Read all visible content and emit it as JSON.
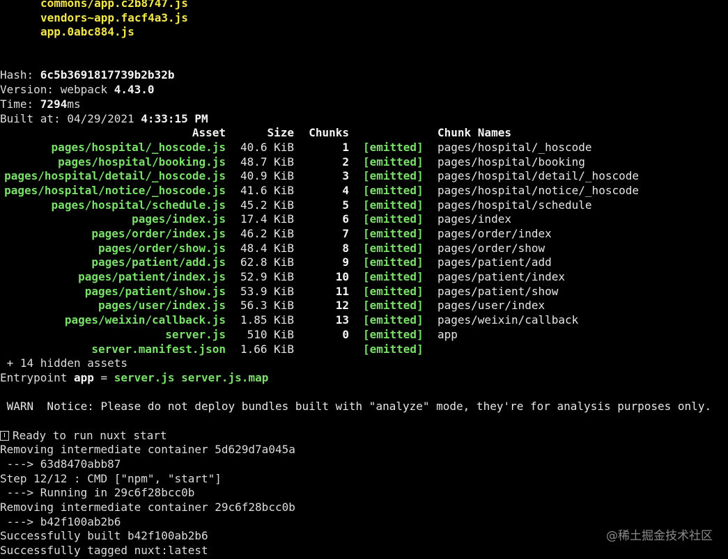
{
  "bundle_files": [
    "commons/app.c2b8747.js",
    "vendors~app.facf4a3.js",
    "app.0abc884.js"
  ],
  "build_info": {
    "hash_label": "Hash: ",
    "hash_value": "6c5b3691817739b2b32b",
    "version_label": "Version: webpack ",
    "version_value": "4.43.0",
    "time_label": "Time: ",
    "time_value": "7294",
    "time_unit": "ms",
    "built_label": "Built at: 04/29/2021 ",
    "built_time": "4:33:15 PM"
  },
  "table": {
    "headers": {
      "asset": "Asset",
      "size": "Size",
      "chunks": "Chunks",
      "chunk_names": "Chunk Names"
    },
    "rows": [
      {
        "asset": "pages/hospital/_hoscode.js",
        "size": "40.6 KiB",
        "chunks": "1",
        "status": "[emitted]",
        "chunk_name": "pages/hospital/_hoscode"
      },
      {
        "asset": "pages/hospital/booking.js",
        "size": "48.7 KiB",
        "chunks": "2",
        "status": "[emitted]",
        "chunk_name": "pages/hospital/booking"
      },
      {
        "asset": "pages/hospital/detail/_hoscode.js",
        "size": "40.9 KiB",
        "chunks": "3",
        "status": "[emitted]",
        "chunk_name": "pages/hospital/detail/_hoscode"
      },
      {
        "asset": "pages/hospital/notice/_hoscode.js",
        "size": "41.6 KiB",
        "chunks": "4",
        "status": "[emitted]",
        "chunk_name": "pages/hospital/notice/_hoscode"
      },
      {
        "asset": "pages/hospital/schedule.js",
        "size": "45.2 KiB",
        "chunks": "5",
        "status": "[emitted]",
        "chunk_name": "pages/hospital/schedule"
      },
      {
        "asset": "pages/index.js",
        "size": "17.4 KiB",
        "chunks": "6",
        "status": "[emitted]",
        "chunk_name": "pages/index"
      },
      {
        "asset": "pages/order/index.js",
        "size": "46.2 KiB",
        "chunks": "7",
        "status": "[emitted]",
        "chunk_name": "pages/order/index"
      },
      {
        "asset": "pages/order/show.js",
        "size": "48.4 KiB",
        "chunks": "8",
        "status": "[emitted]",
        "chunk_name": "pages/order/show"
      },
      {
        "asset": "pages/patient/add.js",
        "size": "62.8 KiB",
        "chunks": "9",
        "status": "[emitted]",
        "chunk_name": "pages/patient/add"
      },
      {
        "asset": "pages/patient/index.js",
        "size": "52.9 KiB",
        "chunks": "10",
        "status": "[emitted]",
        "chunk_name": "pages/patient/index"
      },
      {
        "asset": "pages/patient/show.js",
        "size": "53.9 KiB",
        "chunks": "11",
        "status": "[emitted]",
        "chunk_name": "pages/patient/show"
      },
      {
        "asset": "pages/user/index.js",
        "size": "56.3 KiB",
        "chunks": "12",
        "status": "[emitted]",
        "chunk_name": "pages/user/index"
      },
      {
        "asset": "pages/weixin/callback.js",
        "size": "1.85 KiB",
        "chunks": "13",
        "status": "[emitted]",
        "chunk_name": "pages/weixin/callback"
      },
      {
        "asset": "server.js",
        "size": "510 KiB",
        "chunks": "0",
        "status": "[emitted]",
        "chunk_name": "app"
      },
      {
        "asset": "server.manifest.json",
        "size": "1.66 KiB",
        "chunks": "",
        "status": "[emitted]",
        "chunk_name": ""
      }
    ]
  },
  "hidden_assets": " + 14 hidden assets",
  "entrypoint": {
    "label": "Entrypoint ",
    "name": "app",
    "equals": " = ",
    "files": "server.js server.js.map"
  },
  "warning": " WARN  Notice: Please do not deploy bundles built with \"analyze\" mode, they're for analysis purposes only.",
  "docker_log": {
    "ready_icon": "info-box-icon",
    "ready_text": "Ready to run nuxt start",
    "lines": [
      "Removing intermediate container 5d629d7a045a",
      " ---> 63d8470abb87",
      "Step 12/12 : CMD [\"npm\", \"start\"]",
      " ---> Running in 29c6f28bcc0b",
      "Removing intermediate container 29c6f28bcc0b",
      " ---> b42f100ab2b6",
      "Successfully built b42f100ab2b6",
      "Successfully tagged nuxt:latest"
    ]
  },
  "watermark": "@稀土掘金技术社区",
  "colors": {
    "background": "#000000",
    "text": "#dddddd",
    "yellow": "#f3e84a",
    "green": "#7ae06a"
  }
}
